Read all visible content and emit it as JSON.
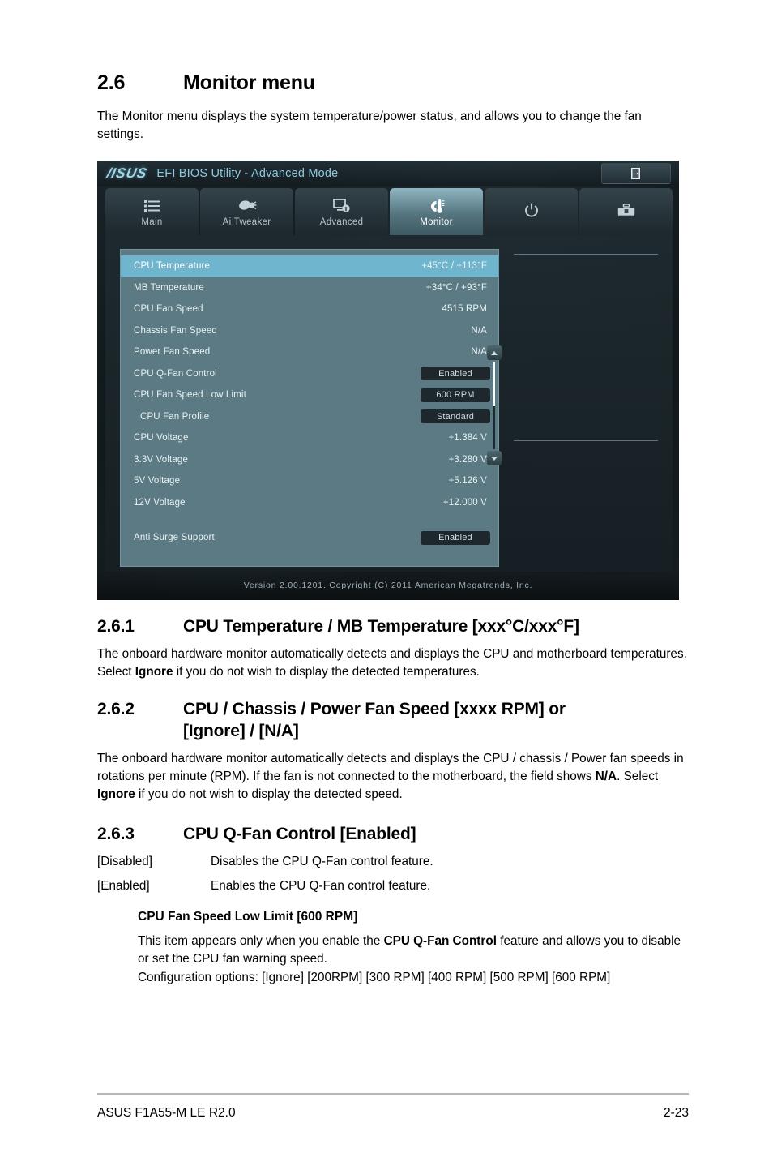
{
  "section": {
    "number": "2.6",
    "title": "Monitor menu",
    "intro": "The Monitor menu displays the system temperature/power status, and allows you to change the fan settings."
  },
  "bios": {
    "logo": "/ISUS",
    "title": "EFI BIOS Utility - Advanced Mode",
    "exit_icon": "exit-door-icon",
    "tabs": [
      {
        "label": "Main",
        "icon": "list-icon",
        "active": false
      },
      {
        "label": "Ai  Tweaker",
        "icon": "tweaker-icon",
        "active": false
      },
      {
        "label": "Advanced",
        "icon": "monitor-info-icon",
        "active": false
      },
      {
        "label": "Monitor",
        "icon": "thermometer-icon",
        "active": true
      },
      {
        "label": "",
        "icon": "power-icon",
        "active": false
      },
      {
        "label": "",
        "icon": "toolbox-icon",
        "active": false
      }
    ],
    "items": [
      {
        "name": "CPU Temperature",
        "value": "+45°C / +113°F",
        "type": "text",
        "selected": true,
        "indent": false
      },
      {
        "name": "MB Temperature",
        "value": "+34°C / +93°F",
        "type": "text",
        "selected": false,
        "indent": false
      },
      {
        "name": "CPU Fan Speed",
        "value": "4515 RPM",
        "type": "text",
        "selected": false,
        "indent": false
      },
      {
        "name": "Chassis Fan Speed",
        "value": "N/A",
        "type": "text",
        "selected": false,
        "indent": false
      },
      {
        "name": "Power Fan Speed",
        "value": "N/A",
        "type": "text",
        "selected": false,
        "indent": false
      },
      {
        "name": "CPU Q-Fan Control",
        "value": "Enabled",
        "type": "chip",
        "selected": false,
        "indent": false
      },
      {
        "name": "CPU Fan Speed Low Limit",
        "value": "600 RPM",
        "type": "chip",
        "selected": false,
        "indent": false
      },
      {
        "name": "CPU Fan Profile",
        "value": "Standard",
        "type": "chip",
        "selected": false,
        "indent": true
      },
      {
        "name": "CPU Voltage",
        "value": "+1.384 V",
        "type": "text",
        "selected": false,
        "indent": false
      },
      {
        "name": "3.3V Voltage",
        "value": "+3.280 V",
        "type": "text",
        "selected": false,
        "indent": false
      },
      {
        "name": "5V Voltage",
        "value": "+5.126 V",
        "type": "text",
        "selected": false,
        "indent": false
      },
      {
        "name": "12V Voltage",
        "value": "+12.000 V",
        "type": "text",
        "selected": false,
        "indent": false
      },
      {
        "name": "",
        "value": "",
        "type": "spacer",
        "selected": false,
        "indent": false
      },
      {
        "name": "Anti Surge Support",
        "value": "Enabled",
        "type": "chip",
        "selected": false,
        "indent": false
      }
    ],
    "footer": "Version 2.00.1201.  Copyright (C) 2011 American Megatrends, Inc.",
    "colors": {
      "highlight": "#6fb5ce",
      "panel": "#5c7a83",
      "chip": "#1d272c",
      "accent": "#8fc9dd"
    }
  },
  "sub1": {
    "number": "2.6.1",
    "title": "CPU Temperature / MB Temperature [xxx°C/xxx°F]",
    "body_a": "The onboard hardware monitor automatically detects and displays the CPU and motherboard temperatures. Select ",
    "body_b": "Ignore",
    "body_c": " if you do not wish to display the detected temperatures."
  },
  "sub2": {
    "number": "2.6.2",
    "title_line1": "CPU / Chassis / Power Fan Speed [xxxx RPM] or",
    "title_line2": "[Ignore] / [N/A]",
    "body_a": "The onboard hardware monitor automatically detects and displays the CPU / chassis / Power fan speeds in rotations per minute (RPM). If the fan is not connected to the motherboard, the field shows ",
    "body_b": "N/A",
    "body_c": ". Select ",
    "body_d": "Ignore",
    "body_e": " if you do not wish to display the detected speed."
  },
  "sub3": {
    "number": "2.6.3",
    "title": "CPU Q-Fan Control [Enabled]",
    "options": [
      {
        "key": "[Disabled]",
        "desc": "Disables the CPU Q-Fan control feature."
      },
      {
        "key": "[Enabled]",
        "desc": "Enables the CPU Q-Fan control feature."
      }
    ],
    "subhead": "CPU Fan Speed Low Limit [600 RPM]",
    "sub_a": "This item appears only when you enable the ",
    "sub_b": "CPU Q-Fan Control",
    "sub_c": " feature and allows you to disable or set the CPU fan warning speed.",
    "sub_d": "Configuration options: [Ignore] [200RPM] [300 RPM] [400 RPM] [500 RPM] [600 RPM]"
  },
  "page_footer": {
    "left": "ASUS F1A55-M LE R2.0",
    "right": "2-23"
  }
}
